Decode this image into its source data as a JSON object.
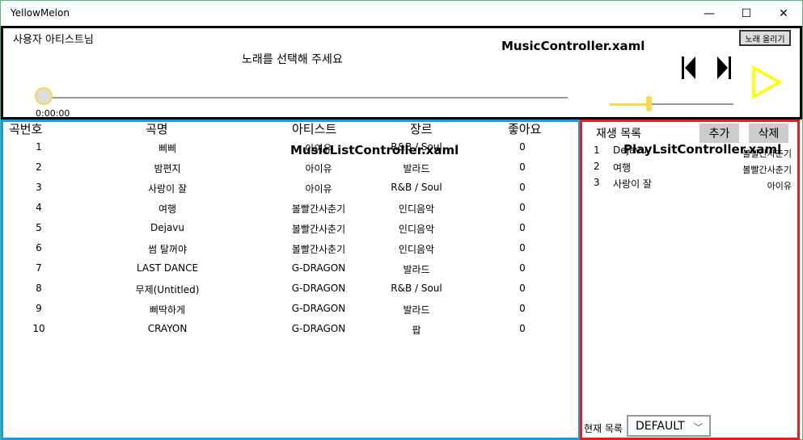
{
  "window": {
    "title": "YellowMelon",
    "min_icon": "—",
    "max_icon": "☐",
    "close_icon": "✕"
  },
  "music_controller": {
    "user_label": "사용자 아티스트님",
    "filename": "MusicController.xaml",
    "upload_button": "노래 올리기",
    "song_prompt": "노래를 선택해 주세요",
    "time": "0:00:00",
    "progress": 0,
    "volume": 0.3,
    "accent_color": "#f5d94a",
    "play_color": "#ffff00",
    "icons": {
      "prev": "skip-previous-icon",
      "next": "skip-next-icon",
      "play": "play-icon"
    }
  },
  "music_list": {
    "filename": "MusicListController.xaml",
    "border_color": "#1a9ae0",
    "headers": [
      "곡번호",
      "곡명",
      "아티스트",
      "장르",
      "좋아요"
    ],
    "rows": [
      {
        "num": "1",
        "title": "삐삐",
        "artist": "아이유",
        "genre": "R&B / Soul",
        "likes": "0"
      },
      {
        "num": "2",
        "title": "밤편지",
        "artist": "아이유",
        "genre": "발라드",
        "likes": "0"
      },
      {
        "num": "3",
        "title": "사랑이 잘",
        "artist": "아이유",
        "genre": "R&B / Soul",
        "likes": "0"
      },
      {
        "num": "4",
        "title": "여행",
        "artist": "볼빨간사춘기",
        "genre": "인디음악",
        "likes": "0"
      },
      {
        "num": "5",
        "title": "Dejavu",
        "artist": "볼빨간사춘기",
        "genre": "인디음악",
        "likes": "0"
      },
      {
        "num": "6",
        "title": "썸 탈꺼야",
        "artist": "볼빨간사춘기",
        "genre": "인디음악",
        "likes": "0"
      },
      {
        "num": "7",
        "title": "LAST DANCE",
        "artist": "G-DRAGON",
        "genre": "발라드",
        "likes": "0"
      },
      {
        "num": "8",
        "title": "무제(Untitled)",
        "artist": "G-DRAGON",
        "genre": "R&B / Soul",
        "likes": "0"
      },
      {
        "num": "9",
        "title": "삐딱하게",
        "artist": "G-DRAGON",
        "genre": "발라드",
        "likes": "0"
      },
      {
        "num": "10",
        "title": "CRAYON",
        "artist": "G-DRAGON",
        "genre": "팝",
        "likes": "0"
      }
    ]
  },
  "playlist": {
    "filename": "PlayLsitController.xaml",
    "border_color": "#e02020",
    "title": "재생 목록",
    "add_button": "추가",
    "delete_button": "삭제",
    "items": [
      {
        "num": "1",
        "title": "Dejavu",
        "artist": "볼빨간사춘기"
      },
      {
        "num": "2",
        "title": "여행",
        "artist": "볼빨간사춘기"
      },
      {
        "num": "3",
        "title": "사랑이 잘",
        "artist": "아이유"
      }
    ],
    "current_label": "현재 목록",
    "current_value": "DEFAULT"
  }
}
